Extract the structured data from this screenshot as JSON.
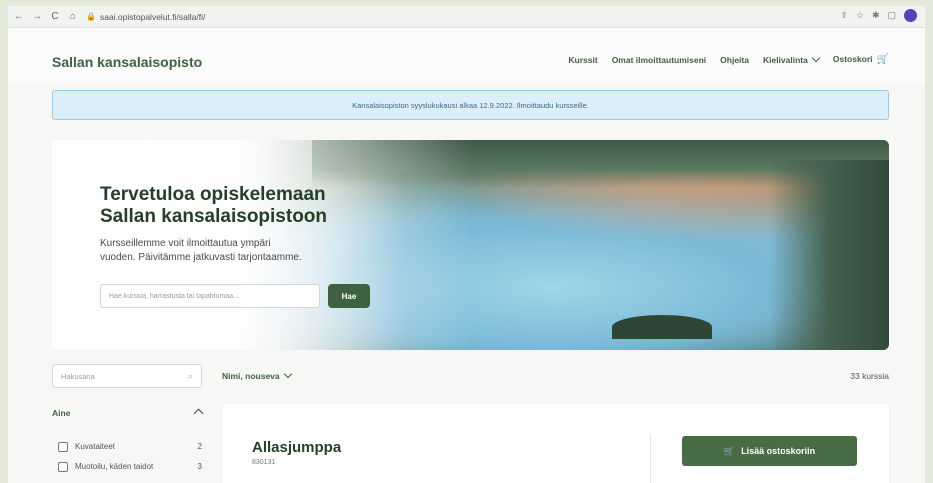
{
  "browser": {
    "url": "saai.opistopalvelut.fi/salla/fi/"
  },
  "header": {
    "brand": "Sallan kansalaisopisto",
    "nav": {
      "courses": "Kurssit",
      "my_registrations": "Omat ilmoittautumiseni",
      "help": "Ohjeita",
      "language": "Kielivalinta",
      "cart": "Ostoskori"
    }
  },
  "notice": {
    "text": "Kansalaisopiston syyslukukausi alkaa 12.9.2022. Ilmoittaudu kursseille."
  },
  "hero": {
    "title_line1": "Tervetuloa opiskelemaan",
    "title_line2": "Sallan kansalaisopistoon",
    "subtitle_line1": "Kursseillemme voit ilmoittautua ympäri",
    "subtitle_line2": "vuoden. Päivitämme jatkuvasti tarjontaamme.",
    "search_placeholder": "Hae kurssia, harrastusta tai tapahtumaa...",
    "search_button": "Hae"
  },
  "filters": {
    "search_placeholder": "Hakusana",
    "sort_label": "Nimi, nouseva",
    "result_count": "33 kurssia",
    "subject_heading": "Aine",
    "subjects": [
      {
        "label": "Kuvataiteet",
        "count": "2"
      },
      {
        "label": "Muotoilu, käden taidot",
        "count": "3"
      }
    ]
  },
  "course": {
    "name": "Allasjumppa",
    "id": "830131",
    "add_to_cart": "Lisää ostoskoriin"
  }
}
